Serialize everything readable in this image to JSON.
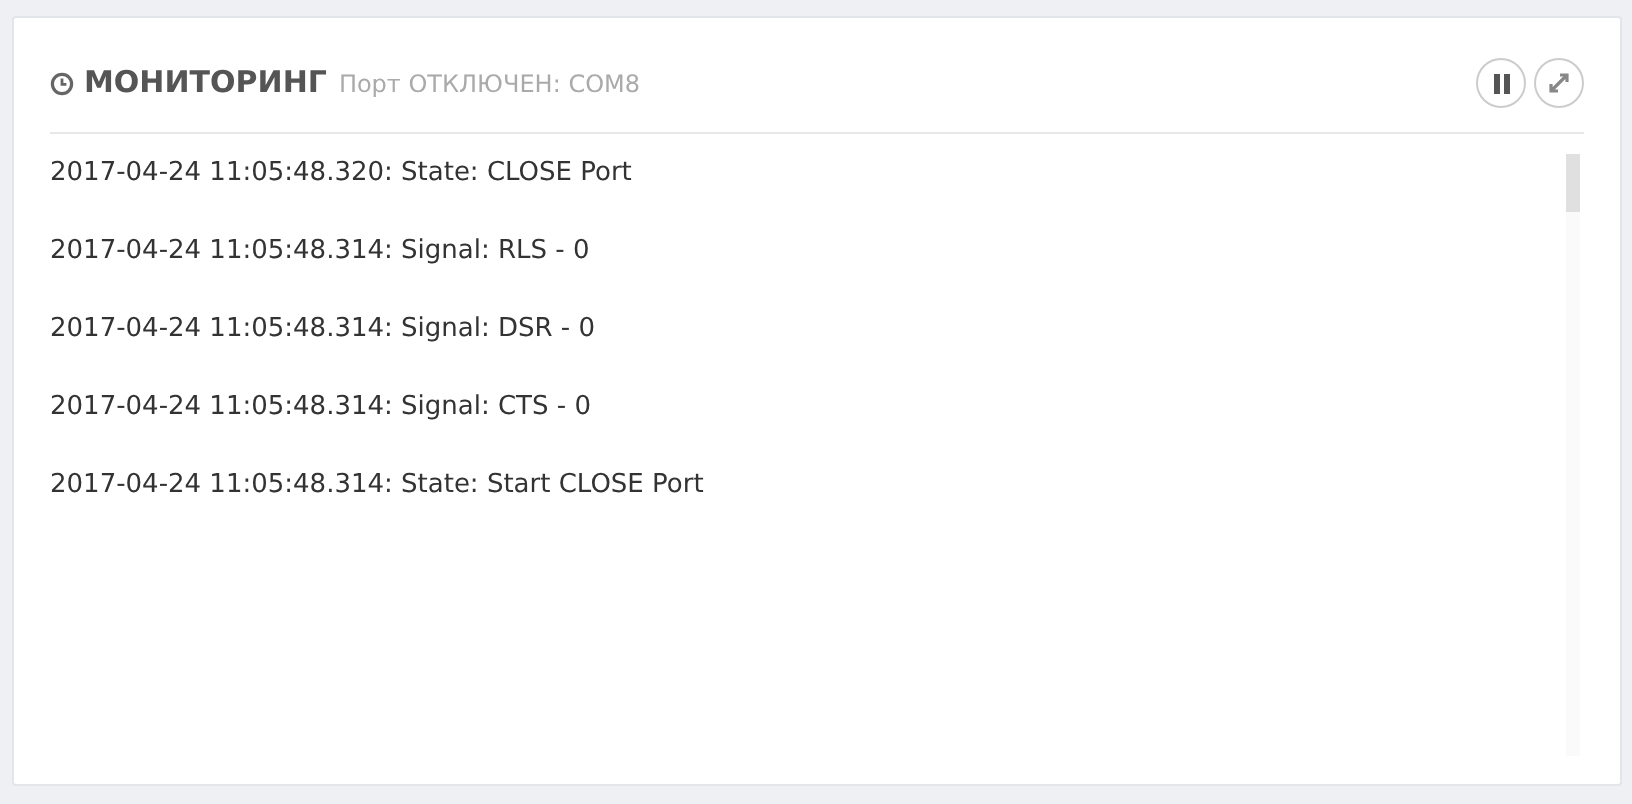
{
  "panel": {
    "title": "МОНИТОРИНГ",
    "subtitle": "Порт ОТКЛЮЧЕН: COM8"
  },
  "log": [
    {
      "text": "2017-04-24 11:05:48.320: State: CLOSE Port"
    },
    {
      "text": "2017-04-24 11:05:48.314: Signal: RLS - 0"
    },
    {
      "text": "2017-04-24 11:05:48.314: Signal: DSR - 0"
    },
    {
      "text": "2017-04-24 11:05:48.314: Signal: CTS - 0"
    },
    {
      "text": "2017-04-24 11:05:48.314: State: Start CLOSE Port"
    }
  ]
}
